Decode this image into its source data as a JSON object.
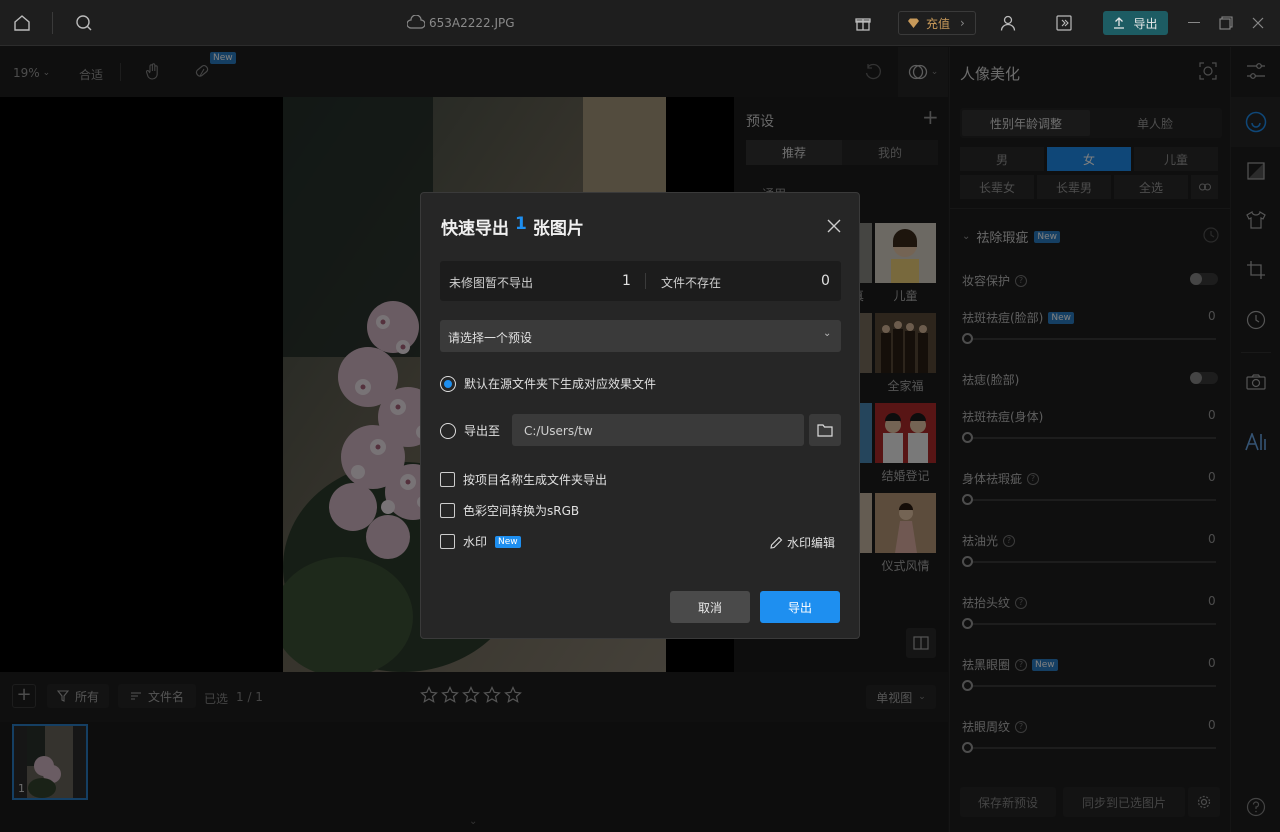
{
  "topbar": {
    "filename": "653A2222.JPG",
    "recharge_label": "充值",
    "export_label": "导出"
  },
  "toolbar": {
    "zoom": "19%",
    "fit_label": "合适",
    "new_badge": "New"
  },
  "presets": {
    "title": "预设",
    "tabs": [
      "推荐",
      "我的"
    ],
    "section": "通用",
    "items": [
      {
        "label": "真"
      },
      {
        "label": "儿童"
      },
      {
        "label": "全家福"
      },
      {
        "label": "结婚登记"
      },
      {
        "label": "仪式风情"
      }
    ]
  },
  "filmbar": {
    "all_label": "所有",
    "filename_label": "文件名",
    "selected_label": "已选",
    "selected_count": "1 / 1",
    "rating": 0,
    "view_label": "单视图"
  },
  "filmstrip": {
    "thumb_index": "1"
  },
  "right_panel": {
    "title": "人像美化",
    "tabs": [
      "性别年龄调整",
      "单人脸"
    ],
    "gender": [
      "男",
      "女",
      "儿童"
    ],
    "age": [
      "长辈女",
      "长辈男",
      "全选"
    ],
    "section_title": "祛除瑕疵",
    "new_badge": "New",
    "rows": [
      {
        "label": "妆容保护",
        "type": "toggle",
        "help": true,
        "badge": false
      },
      {
        "label": "祛斑祛痘(脸部)",
        "type": "slider",
        "value": "0",
        "help": false,
        "badge": true
      },
      {
        "label": "祛痣(脸部)",
        "type": "toggle",
        "help": false,
        "badge": false
      },
      {
        "label": "祛斑祛痘(身体)",
        "type": "slider",
        "value": "0",
        "help": false,
        "badge": false
      },
      {
        "label": "身体祛瑕疵",
        "type": "slider",
        "value": "0",
        "help": true,
        "badge": false
      },
      {
        "label": "祛油光",
        "type": "slider",
        "value": "0",
        "help": true,
        "badge": false
      },
      {
        "label": "祛抬头纹",
        "type": "slider",
        "value": "0",
        "help": true,
        "badge": false
      },
      {
        "label": "祛黑眼圈",
        "type": "slider",
        "value": "0",
        "help": true,
        "badge": true
      },
      {
        "label": "祛眼周纹",
        "type": "slider",
        "value": "0",
        "help": true,
        "badge": false
      }
    ],
    "save_preset_label": "保存新预设",
    "sync_label": "同步到已选图片"
  },
  "modal": {
    "title_prefix": "快速导出",
    "title_count": "1",
    "title_suffix": "张图片",
    "stat1_label": "未修图暂不导出",
    "stat1_value": "1",
    "stat2_label": "文件不存在",
    "stat2_value": "0",
    "preset_placeholder": "请选择一个预设",
    "radio_default_label": "默认在源文件夹下生成对应效果文件",
    "radio_export_label": "导出至",
    "export_path": "C:/Users/tw",
    "check1_label": "按项目名称生成文件夹导出",
    "check2_label": "色彩空间转换为sRGB",
    "check3_label": "水印",
    "new_badge": "New",
    "watermark_edit_label": "水印编辑",
    "cancel_label": "取消",
    "export_label": "导出"
  },
  "colors": {
    "accent": "#1e8ff0",
    "export_btn_bg": "#1d5c63",
    "new_badge": "#2b7fc7"
  }
}
